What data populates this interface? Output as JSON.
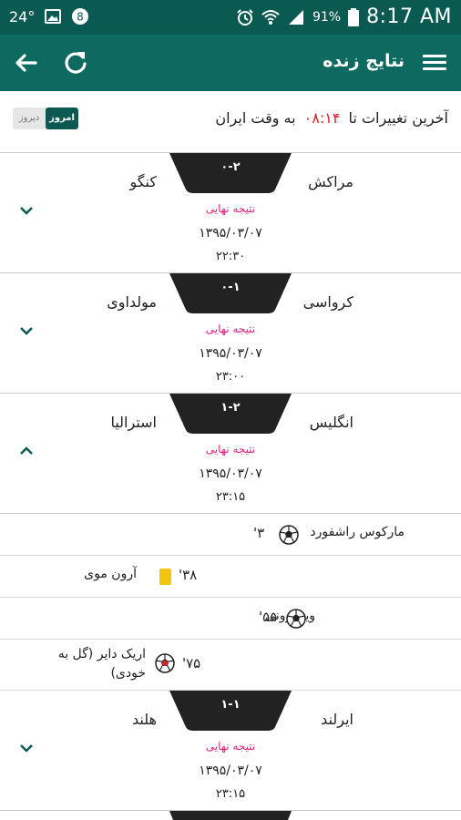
{
  "status_bar": {
    "temperature": "24°",
    "battery_percent": "91%",
    "clock": "8:17 AM"
  },
  "app_bar": {
    "title": "نتایج زنده",
    "back_icon": "arrow-left-icon",
    "refresh_icon": "refresh-icon",
    "menu_icon": "hamburger-menu-icon"
  },
  "info": {
    "prefix": "آخرین تغییرات تا",
    "time": "۰۸:۱۴",
    "suffix": "به وقت ایران",
    "toggle_today": "امروز",
    "toggle_yesterday": "دیروز"
  },
  "colors": {
    "header": "#0e6a60",
    "status_bar": "#0b5a52",
    "score_tab": "#222222",
    "final_status": "#e0207a",
    "time_highlight": "#e0202a"
  },
  "matches": [
    {
      "home": "مراکش",
      "away": "کنگو",
      "score": "۰-۲",
      "status": "نتیجه نهایی",
      "date": "۱۳۹۵/۰۳/۰۷",
      "time": "۲۲:۳۰",
      "expanded": false
    },
    {
      "home": "کرواسی",
      "away": "مولداوی",
      "score": "۰-۱",
      "status": "نتیجه نهایی",
      "date": "۱۳۹۵/۰۳/۰۷",
      "time": "۲۳:۰۰",
      "expanded": false
    },
    {
      "home": "انگلیس",
      "away": "استرالیا",
      "score": "۱-۲",
      "status": "نتیجه نهایی",
      "date": "۱۳۹۵/۰۳/۰۷",
      "time": "۲۳:۱۵",
      "expanded": true
    },
    {
      "home": "ایرلند",
      "away": "هلند",
      "score": "۱-۱",
      "status": "نتیجه نهایی",
      "date": "۱۳۹۵/۰۳/۰۷",
      "time": "۲۳:۱۵",
      "expanded": false
    }
  ],
  "events": [
    {
      "player": "مارکوس راشفورد",
      "minute": "'۳",
      "type": "goal-icon",
      "side": "home"
    },
    {
      "player": "آرون موی",
      "minute": "'۳۸",
      "type": "yellow-card-icon",
      "side": "away"
    },
    {
      "player": "وین رونی",
      "minute": "'۵۵",
      "type": "goal-icon",
      "side": "home"
    },
    {
      "player": "اریک دایر (گل به خودی)",
      "minute": "'۷۵",
      "type": "own-goal-icon",
      "side": "away"
    }
  ]
}
